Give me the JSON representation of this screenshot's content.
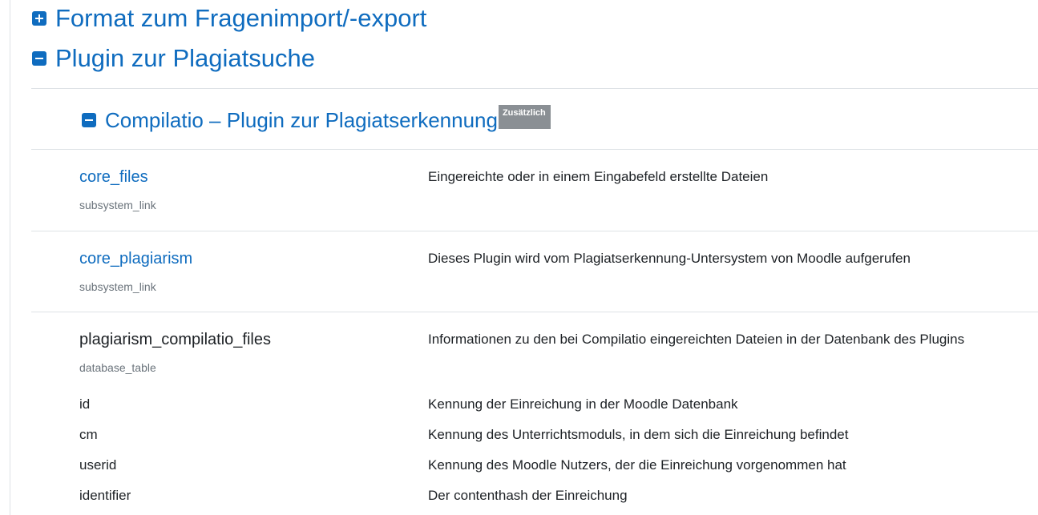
{
  "sections": {
    "format": {
      "label": "Format zum Fragenimport/-export",
      "state": "collapsed"
    },
    "plagiarism": {
      "label": "Plugin zur Plagiatsuche",
      "state": "expanded"
    }
  },
  "compilatio": {
    "label": "Compilatio – Plugin zur Plagiatserkennung",
    "badge": "Zusätzlich",
    "state": "expanded"
  },
  "items": [
    {
      "name": "core_files",
      "type": "subsystem_link",
      "description": "Eingereichte oder in einem Eingabefeld erstellte Dateien"
    },
    {
      "name": "core_plagiarism",
      "type": "subsystem_link",
      "description": "Dieses Plugin wird vom Plagiatserkennung-Untersystem von Moodle aufgerufen"
    },
    {
      "name": "plagiarism_compilatio_files",
      "type": "database_table",
      "description": "Informationen zu den bei Compilatio eingereichten Dateien in der Datenbank des Plugins"
    }
  ],
  "fields": [
    {
      "name": "id",
      "description": "Kennung der Einreichung in der Moodle Datenbank"
    },
    {
      "name": "cm",
      "description": "Kennung des Unterrichtsmoduls, in dem sich die Einreichung befindet"
    },
    {
      "name": "userid",
      "description": "Kennung des Moodle Nutzers, der die Einreichung vorgenommen hat"
    },
    {
      "name": "identifier",
      "description": "Der contenthash der Einreichung"
    }
  ],
  "colors": {
    "link": "#0f6cbf",
    "badge": "#8a8f94",
    "divider": "#dee2e6",
    "muted": "#6a737b"
  }
}
